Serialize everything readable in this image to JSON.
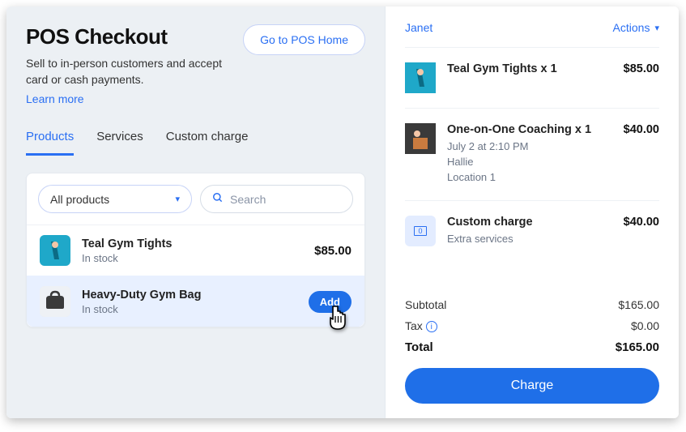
{
  "header": {
    "title": "POS Checkout",
    "subtitle": "Sell to in-person customers and accept card or cash payments.",
    "learn_more": "Learn more",
    "home_button": "Go to POS Home"
  },
  "tabs": [
    "Products",
    "Services",
    "Custom charge"
  ],
  "filters": {
    "dropdown": "All products",
    "search_placeholder": "Search"
  },
  "products": [
    {
      "name": "Teal Gym Tights",
      "stock": "In stock",
      "price": "$85.00"
    },
    {
      "name": "Heavy-Duty Gym Bag",
      "stock": "In stock",
      "add_label": "Add"
    }
  ],
  "cart": {
    "customer": "Janet",
    "actions_label": "Actions",
    "items": [
      {
        "name": "Teal Gym Tights x 1",
        "price": "$85.00"
      },
      {
        "name": "One-on-One Coaching x 1",
        "price": "$40.00",
        "meta": [
          "July 2 at 2:10 PM",
          "Hallie",
          "Location 1"
        ]
      },
      {
        "name": "Custom charge",
        "price": "$40.00",
        "meta": [
          "Extra services"
        ],
        "custom_icon_text": "0"
      }
    ],
    "totals": {
      "subtotal_label": "Subtotal",
      "subtotal": "$165.00",
      "tax_label": "Tax",
      "tax": "$0.00",
      "total_label": "Total",
      "total": "$165.00"
    },
    "charge_button": "Charge"
  }
}
